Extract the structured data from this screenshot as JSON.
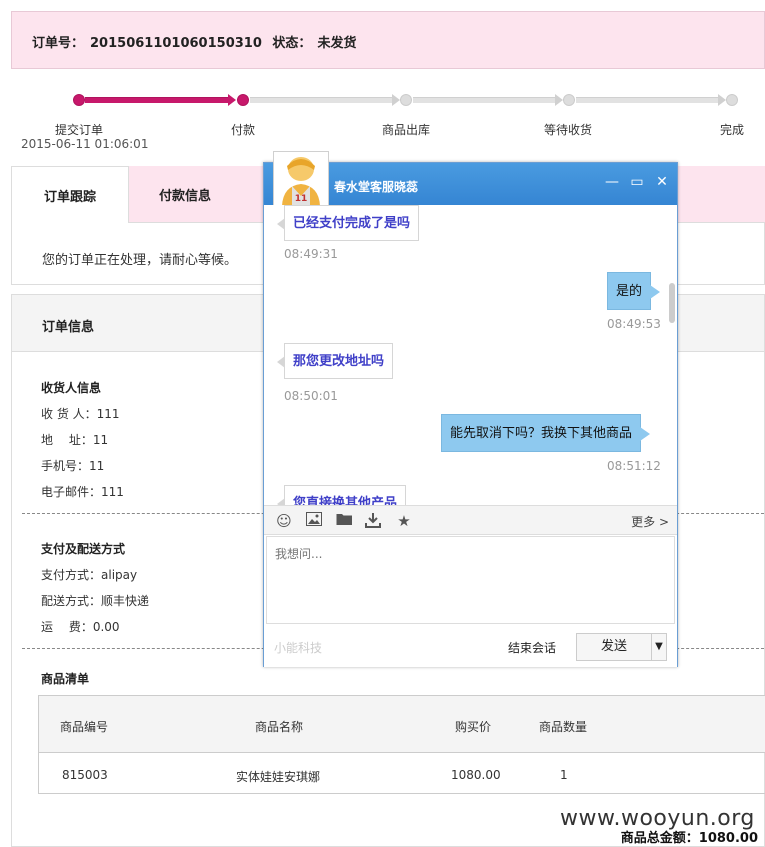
{
  "order": {
    "number_label": "订单号：",
    "number": "2015061101060150310",
    "status_label": "状态：",
    "status": "未发货"
  },
  "progress": {
    "steps": [
      {
        "label": "提交订单",
        "date": "2015-06-11 01:06:01"
      },
      {
        "label": "付款"
      },
      {
        "label": "商品出库"
      },
      {
        "label": "等待收货"
      },
      {
        "label": "完成"
      }
    ]
  },
  "tabs": {
    "tracking": "订单跟踪",
    "payment": "付款信息",
    "processing_text": "您的订单正在处理，请耐心等候。"
  },
  "info": {
    "title": "订单信息",
    "recipient": {
      "title": "收货人信息",
      "name": "收 货 人：111",
      "address": "地　 址：11",
      "phone": "手机号：11",
      "email": "电子邮件：111"
    },
    "payment": {
      "title": "支付及配送方式",
      "method": "支付方式：alipay",
      "delivery": "配送方式：顺丰快递",
      "shipping": "运　 费：0.00"
    },
    "products": {
      "title": "商品清单",
      "headers": [
        "商品编号",
        "商品名称",
        "购买价",
        "商品数量"
      ],
      "rows": [
        [
          "815003",
          "实体娃娃安琪娜",
          "1080.00",
          "1"
        ]
      ]
    },
    "total": "商品总金额：1080.00"
  },
  "watermark": "www.wooyun.org",
  "chat": {
    "agent_name": "春水堂客服晓蕊",
    "messages": [
      {
        "side": "left",
        "text": "已经支付完成了是吗",
        "time": "08:49:31"
      },
      {
        "side": "right",
        "text": "是的",
        "time": "08:49:53"
      },
      {
        "side": "left",
        "text": "那您更改地址吗",
        "time": "08:50:01"
      },
      {
        "side": "right",
        "text": "能先取消下吗？我换下其他商品",
        "time": "08:51:12"
      },
      {
        "side": "left",
        "text": "您直接换其他产品",
        "time": ""
      }
    ],
    "toolbar": {
      "icons": [
        "emoji-icon",
        "image-icon",
        "folder-icon",
        "download-icon",
        "star-icon"
      ],
      "more": "更多 >"
    },
    "input_placeholder": "我想问...",
    "brand": "小能科技",
    "end_session": "结束会话",
    "send": "发送",
    "colors": {
      "title_bar": "#3f91dc",
      "user_bubble": "#8ec9ef",
      "agent_text": "#4040c8"
    }
  },
  "colors": {
    "accent": "#c7186b",
    "header_bg": "#fde4ee"
  }
}
